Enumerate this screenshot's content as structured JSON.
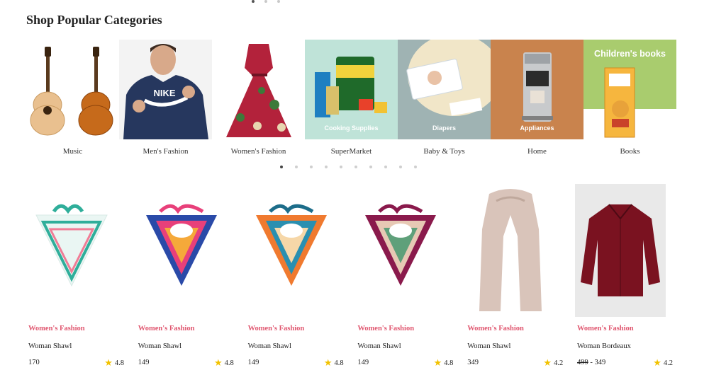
{
  "section": {
    "title": "Shop Popular Categories"
  },
  "categories": [
    {
      "label": "Music",
      "overlay": ""
    },
    {
      "label": "Men's Fashion",
      "overlay": ""
    },
    {
      "label": "Women's Fashion",
      "overlay": ""
    },
    {
      "label": "SuperMarket",
      "overlay": "Cooking Supplies"
    },
    {
      "label": "Baby & Toys",
      "overlay": "Diapers"
    },
    {
      "label": "Home",
      "overlay": "Appliances"
    },
    {
      "label": "Books",
      "overlay": "Children's books"
    }
  ],
  "carousel": {
    "dots": 10,
    "active": 0
  },
  "products": [
    {
      "category": "Women's Fashion",
      "name": "Woman Shawl",
      "price": "170",
      "old_price": "",
      "rating": "4.8"
    },
    {
      "category": "Women's Fashion",
      "name": "Woman Shawl",
      "price": "149",
      "old_price": "",
      "rating": "4.8"
    },
    {
      "category": "Women's Fashion",
      "name": "Woman Shawl",
      "price": "149",
      "old_price": "",
      "rating": "4.8"
    },
    {
      "category": "Women's Fashion",
      "name": "Woman Shawl",
      "price": "149",
      "old_price": "",
      "rating": "4.8"
    },
    {
      "category": "Women's Fashion",
      "name": "Woman Shawl",
      "price": "349",
      "old_price": "",
      "rating": "4.2"
    },
    {
      "category": "Women's Fashion",
      "name": "Woman Bordeaux",
      "price": " - 349",
      "old_price": "499",
      "rating": "4.2"
    }
  ],
  "colors": {
    "accent": "#e0566f",
    "star": "#f2c200"
  },
  "icons": {
    "rating": "star-icon"
  }
}
